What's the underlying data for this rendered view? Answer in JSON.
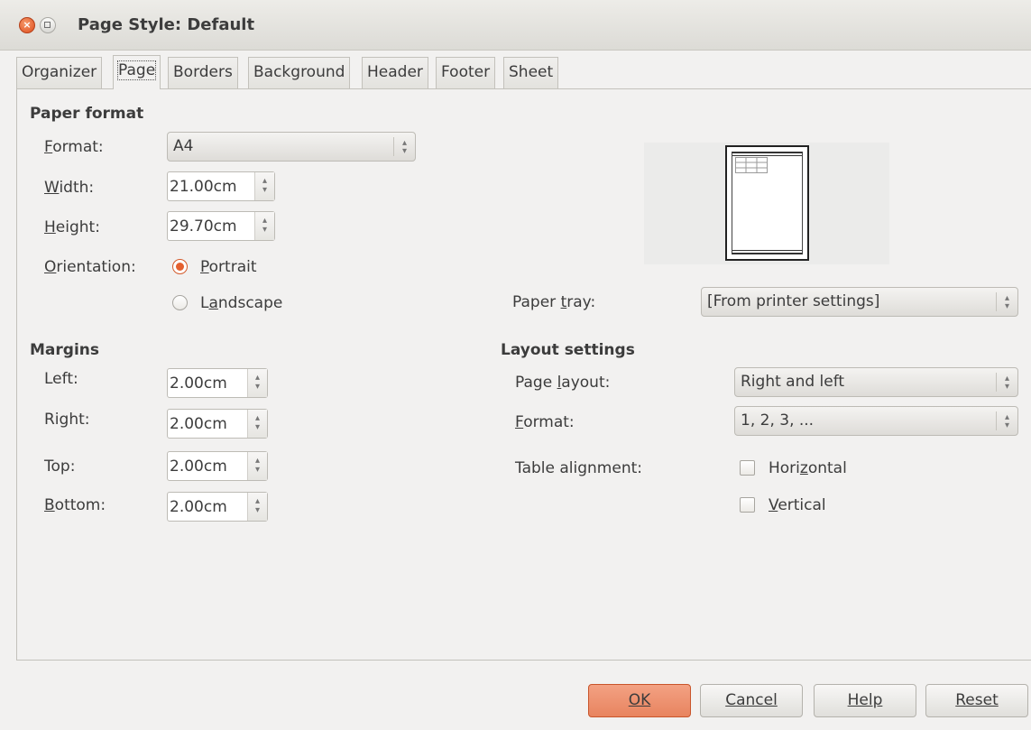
{
  "window": {
    "title": "Page Style: Default"
  },
  "tabs": [
    {
      "label": "Organizer"
    },
    {
      "label": "Page",
      "active": true
    },
    {
      "label": "Borders"
    },
    {
      "label": "Background"
    },
    {
      "label": "Header"
    },
    {
      "label": "Footer"
    },
    {
      "label": "Sheet"
    }
  ],
  "paper_format": {
    "heading": "Paper format",
    "format_label": "Format:",
    "format_value": "A4",
    "width_label": "Width:",
    "width_value": "21.00cm",
    "height_label": "Height:",
    "height_value": "29.70cm",
    "orientation_label": "Orientation:",
    "portrait_label": "Portrait",
    "landscape_label": "Landscape",
    "orientation_selected": "Portrait",
    "paper_tray_label": "Paper tray:",
    "paper_tray_value": "[From printer settings]"
  },
  "margins": {
    "heading": "Margins",
    "left_label": "Left:",
    "left_value": "2.00cm",
    "right_label": "Right:",
    "right_value": "2.00cm",
    "top_label": "Top:",
    "top_value": "2.00cm",
    "bottom_label": "Bottom:",
    "bottom_value": "2.00cm"
  },
  "layout_settings": {
    "heading": "Layout settings",
    "page_layout_label": "Page layout:",
    "page_layout_value": "Right and left",
    "format_label": "Format:",
    "format_value": "1, 2, 3, ...",
    "table_alignment_label": "Table alignment:",
    "horizontal_label": "Horizontal",
    "horizontal_checked": false,
    "vertical_label": "Vertical",
    "vertical_checked": false
  },
  "buttons": {
    "ok": "OK",
    "cancel": "Cancel",
    "help": "Help",
    "reset": "Reset"
  },
  "colors": {
    "accent": "#e8845f",
    "radio_selected": "#e4602f",
    "background": "#f2f1f0"
  }
}
